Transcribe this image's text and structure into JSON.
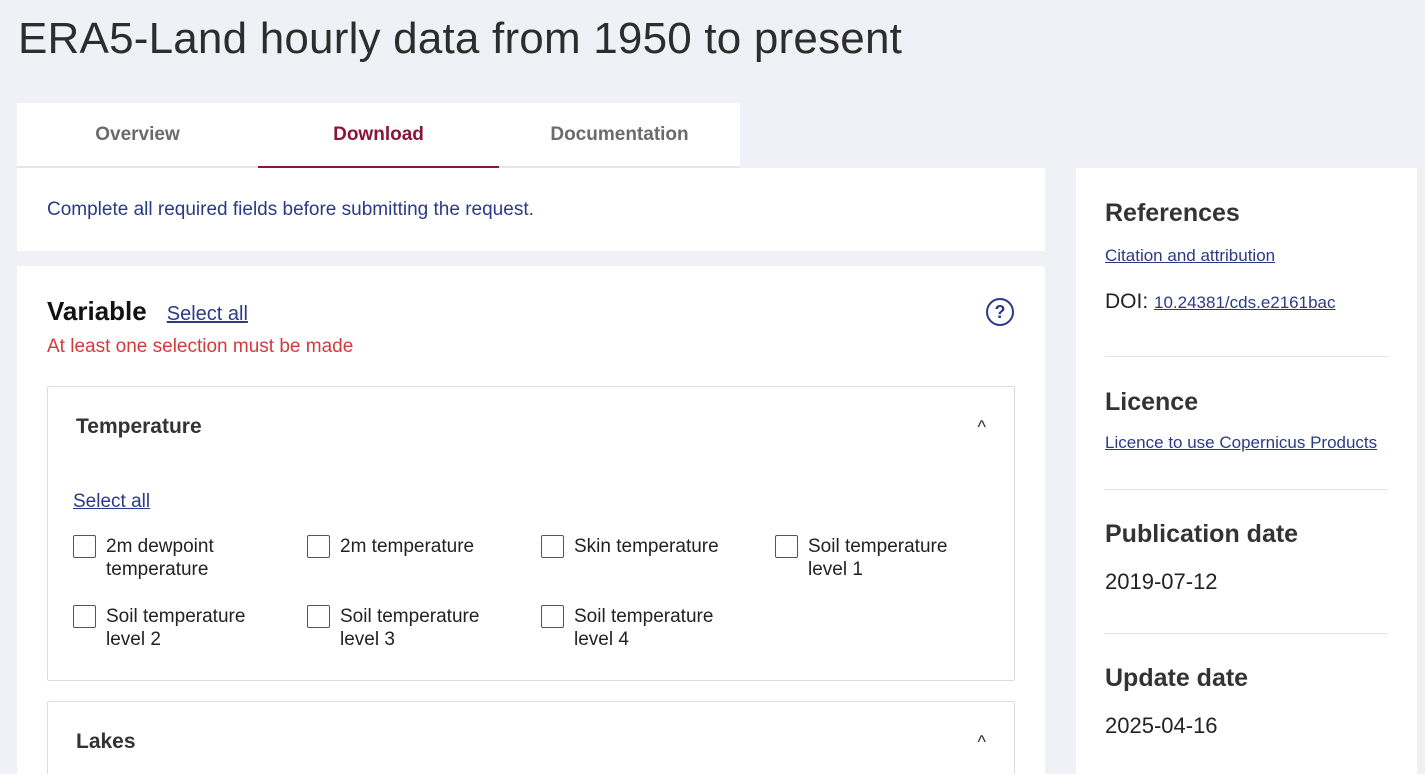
{
  "page": {
    "title": "ERA5-Land hourly data from 1950 to present"
  },
  "tabs": [
    {
      "label": "Overview",
      "active": false
    },
    {
      "label": "Download",
      "active": true
    },
    {
      "label": "Documentation",
      "active": false
    }
  ],
  "notice": {
    "text": "Complete all required fields before submitting the request."
  },
  "variable": {
    "title": "Variable",
    "select_all": "Select all",
    "help_icon": "question-circle-icon",
    "help_glyph": "?",
    "error": "At least one selection must be made",
    "groups": [
      {
        "title": "Temperature",
        "expanded": true,
        "chevron": "^",
        "select_all": "Select all",
        "options": [
          {
            "label": "2m dewpoint temperature",
            "checked": false
          },
          {
            "label": "2m temperature",
            "checked": false
          },
          {
            "label": "Skin temperature",
            "checked": false
          },
          {
            "label": "Soil temperature level 1",
            "checked": false
          },
          {
            "label": "Soil temperature level 2",
            "checked": false
          },
          {
            "label": "Soil temperature level 3",
            "checked": false
          },
          {
            "label": "Soil temperature level 4",
            "checked": false
          }
        ]
      },
      {
        "title": "Lakes",
        "expanded": true,
        "chevron": "^"
      }
    ]
  },
  "sidebar": {
    "references": {
      "title": "References",
      "citation_link": "Citation and attribution",
      "doi_label": "DOI:",
      "doi_value": "10.24381/cds.e2161bac"
    },
    "licence": {
      "title": "Licence",
      "link": "Licence to use Copernicus Products"
    },
    "publication": {
      "title": "Publication date",
      "value": "2019-07-12"
    },
    "update": {
      "title": "Update date",
      "value": "2025-04-16"
    }
  },
  "colors": {
    "accent": "#8b1538",
    "link": "#2b3a87",
    "error": "#d33b3b",
    "background": "#f0f1f6"
  }
}
